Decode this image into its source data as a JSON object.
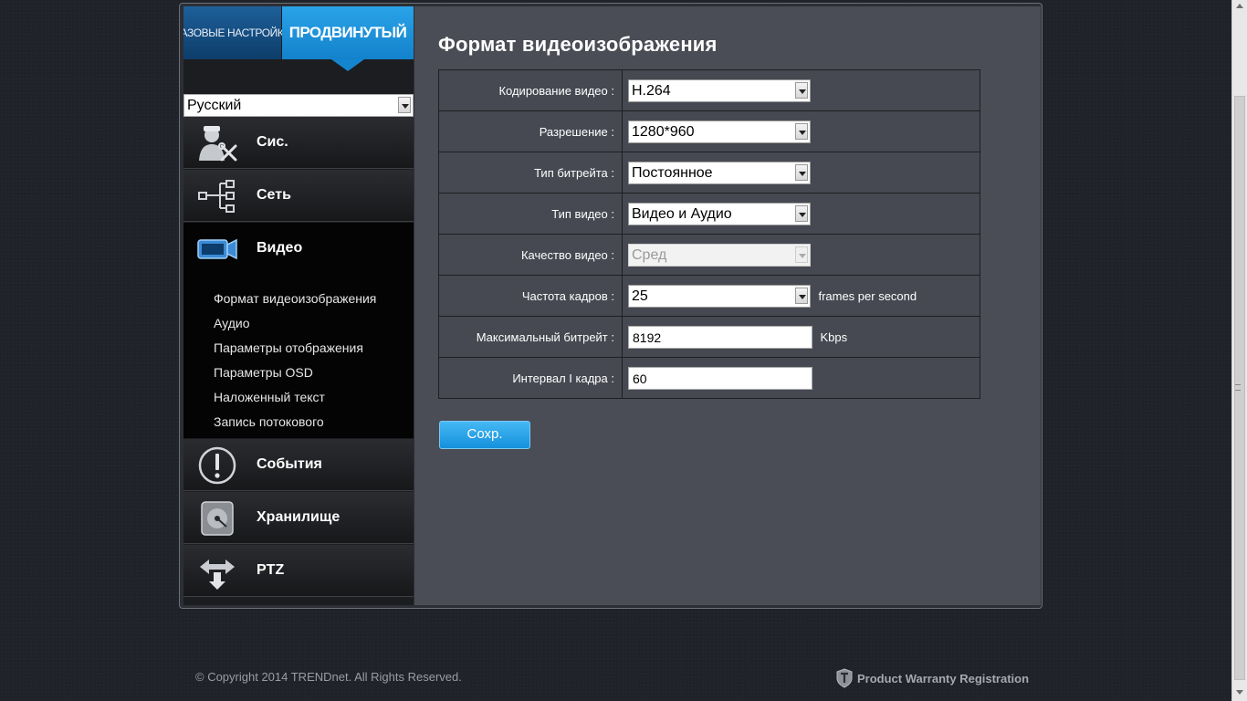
{
  "tabs": {
    "basic_label": "БАЗОВЫЕ НАСТРОЙКИ",
    "advanced_label": "ПРОДВИНУТЫЙ"
  },
  "language": {
    "selected": "Русский"
  },
  "nav": {
    "items": [
      {
        "label": "Сис.",
        "icon": "admin-tools-icon"
      },
      {
        "label": "Сеть",
        "icon": "network-icon"
      },
      {
        "label": "Видео",
        "icon": "video-camera-icon"
      },
      {
        "label": "События",
        "icon": "alert-icon"
      },
      {
        "label": "Хранилище",
        "icon": "storage-disk-icon"
      },
      {
        "label": "PTZ",
        "icon": "ptz-arrows-icon"
      }
    ],
    "video_subitems": [
      "Формат видеоизображения",
      "Аудио",
      "Параметры отображения",
      "Параметры OSD",
      "Наложенный текст",
      "Запись потокового"
    ]
  },
  "page": {
    "title": "Формат видеоизображения",
    "rows": [
      {
        "label": "Кодирование видео :",
        "value": "H.264"
      },
      {
        "label": "Разрешение :",
        "value": "1280*960"
      },
      {
        "label": "Тип битрейта :",
        "value": "Постоянное"
      },
      {
        "label": "Тип видео :",
        "value": "Видео и Аудио"
      },
      {
        "label": "Качество видео :",
        "value": "Сред"
      },
      {
        "label": "Частота кадров :",
        "value": "25",
        "unit": "frames per second"
      },
      {
        "label": "Максимальный битрейт :",
        "value": "8192",
        "unit": "Kbps"
      },
      {
        "label": "Интервал I кадра :",
        "value": "60"
      }
    ],
    "save_label": "Сохр."
  },
  "footer": {
    "copyright": "© Copyright 2014 TRENDnet. All Rights Reserved.",
    "warranty": "Product Warranty Registration"
  },
  "colors": {
    "accent": "#1a8ee0",
    "content_bg": "#4a4d55",
    "sidebar_bg": "#1c1d20"
  }
}
